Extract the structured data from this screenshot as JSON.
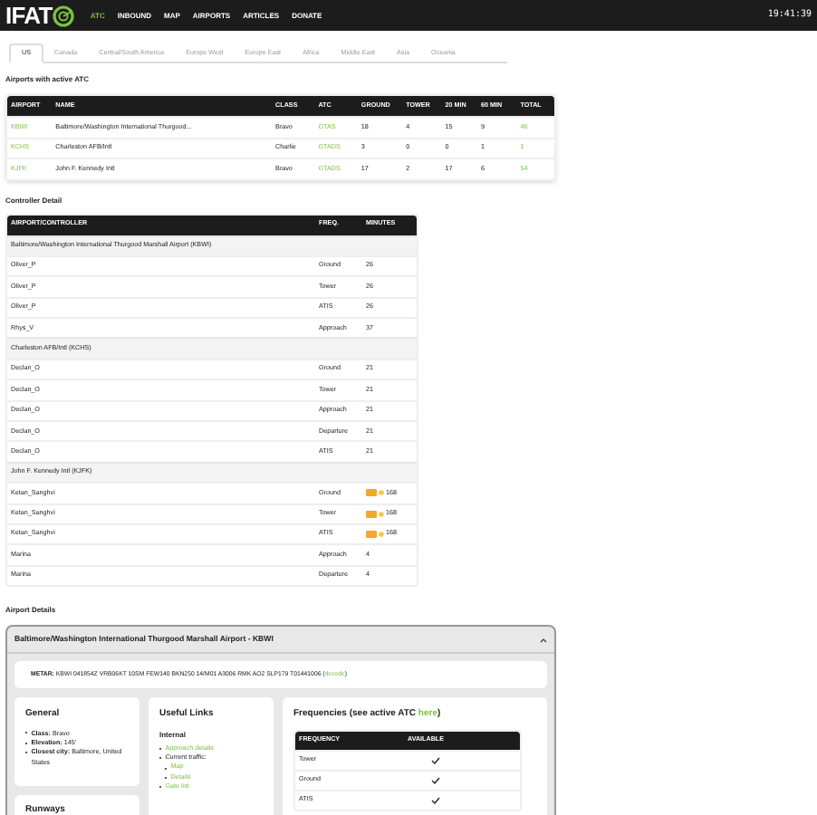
{
  "header": {
    "logo": "IFAT",
    "nav": [
      {
        "label": "ATC",
        "selected": true
      },
      {
        "label": "INBOUND",
        "selected": false
      },
      {
        "label": "MAP",
        "selected": false
      },
      {
        "label": "AIRPORTS",
        "selected": false
      },
      {
        "label": "ARTICLES",
        "selected": false
      },
      {
        "label": "DONATE",
        "selected": false
      }
    ],
    "time": "19:41:39"
  },
  "tabs": [
    {
      "label": "US",
      "selected": true
    },
    {
      "label": "Canada",
      "selected": false
    },
    {
      "label": "Central/South America",
      "selected": false
    },
    {
      "label": "Europe West",
      "selected": false
    },
    {
      "label": "Europe East",
      "selected": false
    },
    {
      "label": "Africa",
      "selected": false
    },
    {
      "label": "Middle East",
      "selected": false
    },
    {
      "label": "Asia",
      "selected": false
    },
    {
      "label": "Oceania",
      "selected": false
    }
  ],
  "airports_heading": "Airports with active ATC",
  "airports_table": {
    "columns": [
      "AIRPORT",
      "NAME",
      "CLASS",
      "ATC",
      "GROUND",
      "TOWER",
      "20 MIN",
      "60 MIN",
      "TOTAL"
    ],
    "rows": [
      {
        "airport": "KBWI",
        "name": "Baltimore/Washington International Thurgood...",
        "class": "Bravo",
        "atc": "GTAS",
        "ground": "18",
        "tower": "4",
        "min20": "15",
        "min60": "9",
        "total": "46"
      },
      {
        "airport": "KCHS",
        "name": "Charleston AFB/Intl",
        "class": "Charlie",
        "atc": "GTADS",
        "ground": "3",
        "tower": "0",
        "min20": "0",
        "min60": "1",
        "total": "1"
      },
      {
        "airport": "KJFK",
        "name": "John F. Kennedy Intl",
        "class": "Bravo",
        "atc": "GTADS",
        "ground": "17",
        "tower": "2",
        "min20": "17",
        "min60": "6",
        "total": "54"
      }
    ]
  },
  "controller_heading": "Controller Detail",
  "controller_table": {
    "columns": [
      "AIRPORT/CONTROLLER",
      "FREQ.",
      "MINUTES"
    ],
    "groups": [
      {
        "airport": "Baltimore/Washington International Thurgood Marshall Airport (KBWI)",
        "rows": [
          {
            "controller": "Oliver_P",
            "freq": "Ground",
            "minutes": "26",
            "badges": false
          },
          {
            "controller": "Oliver_P",
            "freq": "Tower",
            "minutes": "26",
            "badges": false
          },
          {
            "controller": "Oliver_P",
            "freq": "ATIS",
            "minutes": "26",
            "badges": false
          },
          {
            "controller": "Rhys_V",
            "freq": "Approach",
            "minutes": "37",
            "badges": false
          }
        ]
      },
      {
        "airport": "Charleston AFB/Intl (KCHS)",
        "rows": [
          {
            "controller": "Declan_O",
            "freq": "Ground",
            "minutes": "21",
            "badges": false
          },
          {
            "controller": "Declan_O",
            "freq": "Tower",
            "minutes": "21",
            "badges": false
          },
          {
            "controller": "Declan_O",
            "freq": "Approach",
            "minutes": "21",
            "badges": false
          },
          {
            "controller": "Declan_O",
            "freq": "Departure",
            "minutes": "21",
            "badges": false
          },
          {
            "controller": "Declan_O",
            "freq": "ATIS",
            "minutes": "21",
            "badges": false
          }
        ]
      },
      {
        "airport": "John F. Kennedy Intl (KJFK)",
        "rows": [
          {
            "controller": "Ketan_Sanghvi",
            "freq": "Ground",
            "minutes": "168",
            "badges": true
          },
          {
            "controller": "Ketan_Sanghvi",
            "freq": "Tower",
            "minutes": "168",
            "badges": true
          },
          {
            "controller": "Ketan_Sanghvi",
            "freq": "ATIS",
            "minutes": "168",
            "badges": true
          },
          {
            "controller": "Marina",
            "freq": "Approach",
            "minutes": "4",
            "badges": false
          },
          {
            "controller": "Marina",
            "freq": "Departure",
            "minutes": "4",
            "badges": false
          }
        ]
      }
    ]
  },
  "details_heading": "Airport Details",
  "details": {
    "title": "Baltimore/Washington International Thurgood Marshall Airport - KBWI",
    "expanded": true,
    "metar": {
      "label": "METAR:",
      "text": "KBWI 041854Z VRB06KT 10SM FEW140 BKN250 14/M01 A3006 RMK AO2 SLP179 T01441006 (",
      "link": "decode",
      "end": ")"
    },
    "general": {
      "title": "General",
      "items": [
        {
          "label": "Class:",
          "value": "Bravo"
        },
        {
          "label": "Elevation:",
          "value": "145'"
        },
        {
          "label": "Closest city:",
          "value": "Baltimore, United States"
        }
      ]
    },
    "runways": {
      "title": "Runways"
    },
    "links": {
      "title": "Useful Links",
      "subtitle": "Internal",
      "items": [
        {
          "text": "Approach details",
          "link": true
        },
        {
          "text": "Current traffic:",
          "link": false,
          "children": [
            {
              "text": "Map",
              "link": true
            },
            {
              "text": "Details",
              "link": true
            }
          ]
        },
        {
          "text": "Gate list",
          "link": true
        }
      ]
    },
    "frequencies": {
      "title": "Frequencies (see active ATC ",
      "link": "here",
      "end": ")",
      "columns": [
        "FREQUENCY",
        "AVAILABLE"
      ],
      "rows": [
        {
          "name": "Tower",
          "available": true
        },
        {
          "name": "Ground",
          "available": true
        },
        {
          "name": "ATIS",
          "available": true
        }
      ]
    }
  }
}
